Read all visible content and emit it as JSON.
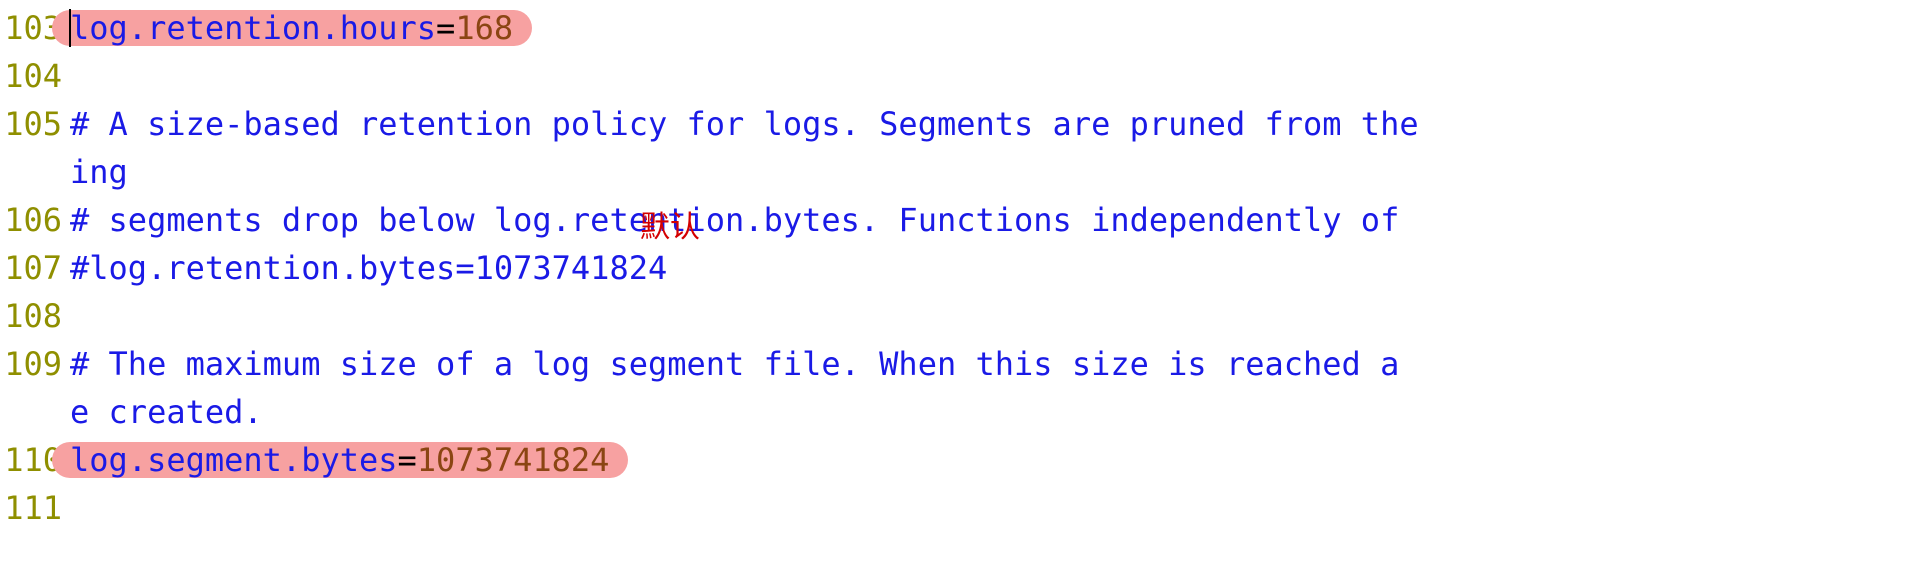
{
  "annotation": "默认",
  "lines": [
    {
      "num": "103",
      "kind": "kv",
      "key": "log.retention.hours",
      "eq": "=",
      "val": "168",
      "hl": true,
      "cursor": true
    },
    {
      "num": "104",
      "kind": "blank",
      "text": ""
    },
    {
      "num": "105",
      "kind": "comment",
      "text": "# A size-based retention policy for logs. Segments are pruned from the"
    },
    {
      "num": "",
      "kind": "wrap",
      "text": "ing"
    },
    {
      "num": "106",
      "kind": "comment",
      "text": "# segments drop below log.retention.bytes. Functions independently of "
    },
    {
      "num": "107",
      "kind": "comment",
      "text": "#log.retention.bytes=1073741824"
    },
    {
      "num": "108",
      "kind": "blank",
      "text": ""
    },
    {
      "num": "109",
      "kind": "comment",
      "text": "# The maximum size of a log segment file. When this size is reached a "
    },
    {
      "num": "",
      "kind": "wrap",
      "text": "e created."
    },
    {
      "num": "110",
      "kind": "kv",
      "key": "log.segment.bytes",
      "eq": "=",
      "val": "1073741824",
      "hl": true
    },
    {
      "num": "111",
      "kind": "blank",
      "text": ""
    }
  ]
}
